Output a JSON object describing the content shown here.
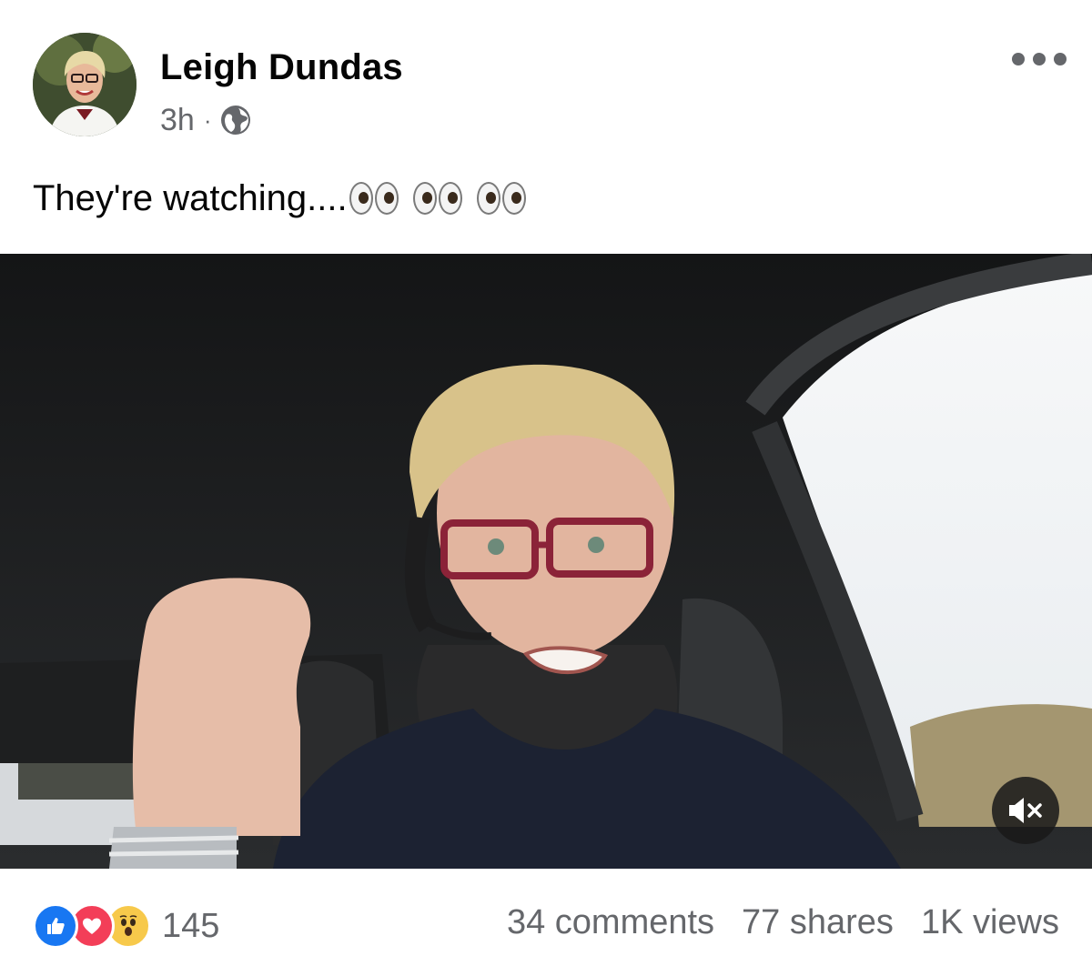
{
  "post": {
    "author": "Leigh Dundas",
    "time": "3h",
    "separator": "·",
    "audience_icon": "globe-icon",
    "more_icon": "more-options-icon",
    "text": "They're watching....",
    "text_emoji": [
      "eyes-emoji",
      "eyes-emoji",
      "eyes-emoji"
    ]
  },
  "video": {
    "mute_icon": "speaker-muted-icon"
  },
  "footer": {
    "reaction_icons": [
      "like-icon",
      "love-icon",
      "wow-icon"
    ],
    "reaction_count": "145",
    "comments": "34 comments",
    "shares": "77 shares",
    "views": "1K views"
  },
  "colors": {
    "like": "#1877f2",
    "love": "#f33e58",
    "wow": "#f7c94b",
    "secondary_text": "#65676b"
  }
}
